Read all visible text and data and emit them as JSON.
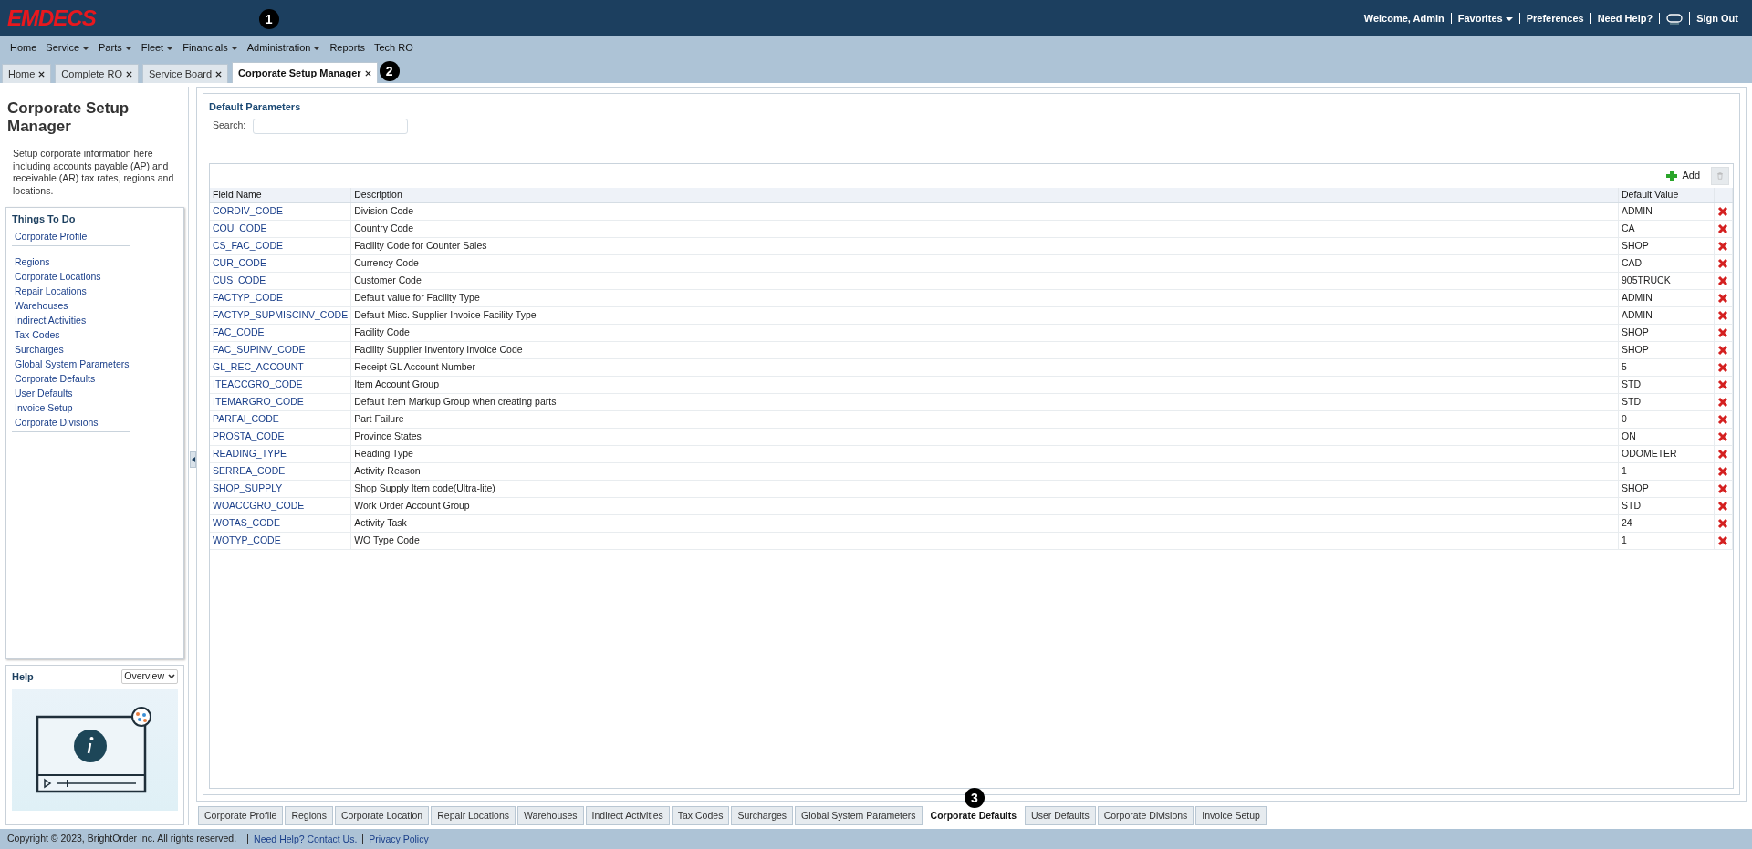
{
  "header": {
    "logo": "EMDECS",
    "callout": "1",
    "user_links": [
      {
        "kind": "text",
        "label": "Welcome, Admin"
      },
      {
        "kind": "dropdown",
        "label": "Favorites"
      },
      {
        "kind": "link",
        "label": "Preferences"
      },
      {
        "kind": "link",
        "label": "Need Help?"
      },
      {
        "kind": "chat"
      },
      {
        "kind": "link",
        "label": "Sign Out"
      }
    ]
  },
  "menu": [
    {
      "label": "Home",
      "dropdown": false
    },
    {
      "label": "Service",
      "dropdown": true
    },
    {
      "label": "Parts",
      "dropdown": true
    },
    {
      "label": "Fleet",
      "dropdown": true
    },
    {
      "label": "Financials",
      "dropdown": true
    },
    {
      "label": "Administration",
      "dropdown": true
    },
    {
      "label": "Reports",
      "dropdown": false
    },
    {
      "label": "Tech RO",
      "dropdown": false
    }
  ],
  "tabs": {
    "callout": "2",
    "items": [
      {
        "label": "Home",
        "selected": false
      },
      {
        "label": "Complete RO",
        "selected": false
      },
      {
        "label": "Service Board",
        "selected": false
      },
      {
        "label": "Corporate Setup Manager",
        "selected": true
      }
    ]
  },
  "sidebar": {
    "title": "Corporate Setup Manager",
    "description": "Setup corporate information here including accounts payable (AP) and receivable (AR) tax rates, regions and locations.",
    "things_to_do": {
      "title": "Things To Do",
      "groups": [
        [
          "Corporate Profile"
        ],
        [
          "Regions",
          "Corporate Locations",
          "Repair Locations",
          "Warehouses",
          "Indirect Activities",
          "Tax Codes",
          "Surcharges",
          "Global System Parameters",
          "Corporate Defaults",
          "User Defaults",
          "Invoice Setup",
          "Corporate Divisions"
        ]
      ]
    },
    "help": {
      "title": "Help",
      "select": "Overview"
    }
  },
  "main": {
    "title": "Default Parameters",
    "search_label": "Search:",
    "add_label": "Add",
    "delete_disabled": true,
    "columns": [
      "Field Name",
      "Description",
      "Default Value"
    ],
    "rows": [
      [
        "CORDIV_CODE",
        "Division Code",
        "ADMIN"
      ],
      [
        "COU_CODE",
        "Country Code",
        "CA"
      ],
      [
        "CS_FAC_CODE",
        "Facility Code for Counter Sales",
        "SHOP"
      ],
      [
        "CUR_CODE",
        "Currency Code",
        "CAD"
      ],
      [
        "CUS_CODE",
        "Customer Code",
        "905TRUCK"
      ],
      [
        "FACTYP_CODE",
        "Default value for Facility Type",
        "ADMIN"
      ],
      [
        "FACTYP_SUPMISCINV_CODE",
        "Default Misc. Supplier Invoice Facility Type",
        "ADMIN"
      ],
      [
        "FAC_CODE",
        "Facility Code",
        "SHOP"
      ],
      [
        "FAC_SUPINV_CODE",
        "Facility Supplier Inventory Invoice Code",
        "SHOP"
      ],
      [
        "GL_REC_ACCOUNT",
        "Receipt GL Account Number",
        "5"
      ],
      [
        "ITEACCGRO_CODE",
        "Item Account Group",
        "STD"
      ],
      [
        "ITEMARGRO_CODE",
        "Default Item Markup Group when creating parts",
        "STD"
      ],
      [
        "PARFAI_CODE",
        "Part Failure",
        "0"
      ],
      [
        "PROSTA_CODE",
        "Province States",
        "ON"
      ],
      [
        "READING_TYPE",
        "Reading Type",
        "ODOMETER"
      ],
      [
        "SERREA_CODE",
        "Activity Reason",
        "1"
      ],
      [
        "SHOP_SUPPLY",
        "Shop Supply Item code(Ultra-lite)",
        "SHOP"
      ],
      [
        "WOACCGRO_CODE",
        "Work Order Account Group",
        "STD"
      ],
      [
        "WOTAS_CODE",
        "Activity Task",
        "24"
      ],
      [
        "WOTYP_CODE",
        "WO Type Code",
        "1"
      ]
    ]
  },
  "bottom_tabs": {
    "callout": "3",
    "items": [
      {
        "label": "Corporate Profile",
        "selected": false
      },
      {
        "label": "Regions",
        "selected": false
      },
      {
        "label": "Corporate Location",
        "selected": false
      },
      {
        "label": "Repair Locations",
        "selected": false
      },
      {
        "label": "Warehouses",
        "selected": false
      },
      {
        "label": "Indirect Activities",
        "selected": false
      },
      {
        "label": "Tax Codes",
        "selected": false
      },
      {
        "label": "Surcharges",
        "selected": false
      },
      {
        "label": "Global System Parameters",
        "selected": false
      },
      {
        "label": "Corporate Defaults",
        "selected": true
      },
      {
        "label": "User Defaults",
        "selected": false
      },
      {
        "label": "Corporate Divisions",
        "selected": false
      },
      {
        "label": "Invoice Setup",
        "selected": false
      }
    ]
  },
  "footer": {
    "copyright": "Copyright © 2023, BrightOrder Inc. All rights reserved.",
    "links": [
      "Need Help? Contact Us.",
      "Privacy Policy"
    ]
  }
}
